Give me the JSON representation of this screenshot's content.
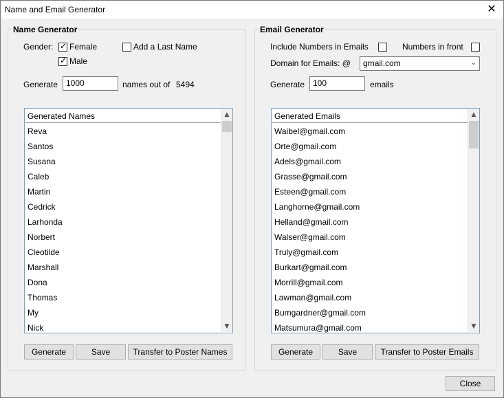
{
  "window": {
    "title": "Name and Email Generator",
    "close_glyph": "✕"
  },
  "name_generator": {
    "title": "Name Generator",
    "gender_label": "Gender:",
    "female_label": "Female",
    "female_checked": true,
    "male_label": "Male",
    "male_checked": true,
    "last_name_label": "Add a Last Name",
    "last_name_checked": false,
    "generate_label": "Generate",
    "generate_value": "1000",
    "names_out_of_label": "names out of",
    "total": "5494",
    "list_header": "Generated Names",
    "items": [
      "Reva",
      "Santos",
      "Susana",
      "Caleb",
      "Martin",
      "Cedrick",
      "Larhonda",
      "Norbert",
      "Cleotilde",
      "Marshall",
      "Dona",
      "Thomas",
      "My",
      "Nick"
    ],
    "buttons": {
      "generate": "Generate",
      "save": "Save",
      "transfer": "Transfer to Poster Names"
    }
  },
  "email_generator": {
    "title": "Email Generator",
    "include_numbers_label": "Include Numbers in Emails",
    "include_numbers_checked": false,
    "numbers_front_label": "Numbers in front",
    "numbers_front_checked": false,
    "domain_label": "Domain for Emails: @",
    "domain_value": "gmail.com",
    "generate_label": "Generate",
    "generate_value": "100",
    "emails_label": "emails",
    "list_header": "Generated Emails",
    "items": [
      "Waibel@gmail.com",
      "Orte@gmail.com",
      "Adels@gmail.com",
      "Grasse@gmail.com",
      "Esteen@gmail.com",
      "Langhorne@gmail.com",
      "Helland@gmail.com",
      "Walser@gmail.com",
      "Truly@gmail.com",
      "Burkart@gmail.com",
      "Morrill@gmail.com",
      "Lawman@gmail.com",
      "Bumgardner@gmail.com",
      "Matsumura@gmail.com"
    ],
    "buttons": {
      "generate": "Generate",
      "save": "Save",
      "transfer": "Transfer to Poster Emails"
    }
  },
  "footer": {
    "close_label": "Close"
  },
  "icons": {
    "check": "✓",
    "scroll_up": "▲",
    "scroll_down": "▼",
    "dropdown": "⌄"
  }
}
